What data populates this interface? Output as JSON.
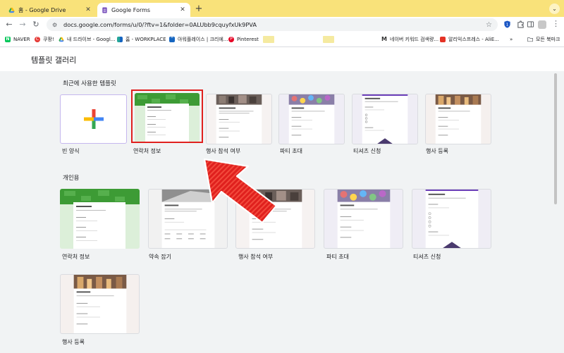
{
  "browser": {
    "tabs": [
      {
        "title": "홈 - Google Drive",
        "icon": "google-drive-icon",
        "active": false
      },
      {
        "title": "Google Forms",
        "icon": "google-forms-icon",
        "active": true
      }
    ],
    "new_tab_symbol": "+",
    "tabs_menu_symbol": "⌄",
    "url": "docs.google.com/forms/u/0/?ftv=1&folder=0ALUbb9cquyfxUk9PVA",
    "bookmarks": [
      {
        "label": "NAVER",
        "icon": "naver-icon",
        "color": "#03c75a"
      },
      {
        "label": "쿠팡!",
        "icon": "coupang-icon",
        "color": "#e53935"
      },
      {
        "label": "내 드라이브 - Googl...",
        "icon": "google-drive-icon",
        "color": "#1e88e5"
      },
      {
        "label": "홈 - WORKPLACE",
        "icon": "workplace-icon",
        "color": "#26a69a"
      },
      {
        "label": "아워플레이스 | 크리에...",
        "icon": "ourplace-icon",
        "color": "#1565c0"
      },
      {
        "label": "Pinterest",
        "icon": "pinterest-icon",
        "color": "#e60023"
      },
      {
        "label": "",
        "icon": "blank-bookmark-icon",
        "color": "#f5eaa0"
      },
      {
        "label": "",
        "icon": "blank-bookmark-icon",
        "color": "#f5eaa0"
      },
      {
        "label": "네이버 키워드 검색량...",
        "icon": "m-icon",
        "color": "#333333"
      },
      {
        "label": "알리익스프레스 - AliE...",
        "icon": "aliexpress-icon",
        "color": "#e43225"
      }
    ],
    "more_bookmarks": "»",
    "all_bookmarks": "모든 북마크"
  },
  "page": {
    "title": "템플릿 갤러리",
    "recent_section": "최근에 사용한 템플릿",
    "personal_section": "개인용",
    "recent_templates": [
      "빈 양식",
      "연락처 정보",
      "행사 참석 여부",
      "파티 초대",
      "티셔츠 신청",
      "행사 등록"
    ],
    "personal_templates": [
      "연락처 정보",
      "약속 잡기",
      "행사 참석 여부",
      "파티 초대",
      "티셔츠 신청",
      "행사 등록"
    ]
  },
  "colors": {
    "tabstrip": "#f9e27a",
    "highlight": "#e0201e",
    "arrow": "#e0201e",
    "contact_green": "#3d9b35"
  }
}
